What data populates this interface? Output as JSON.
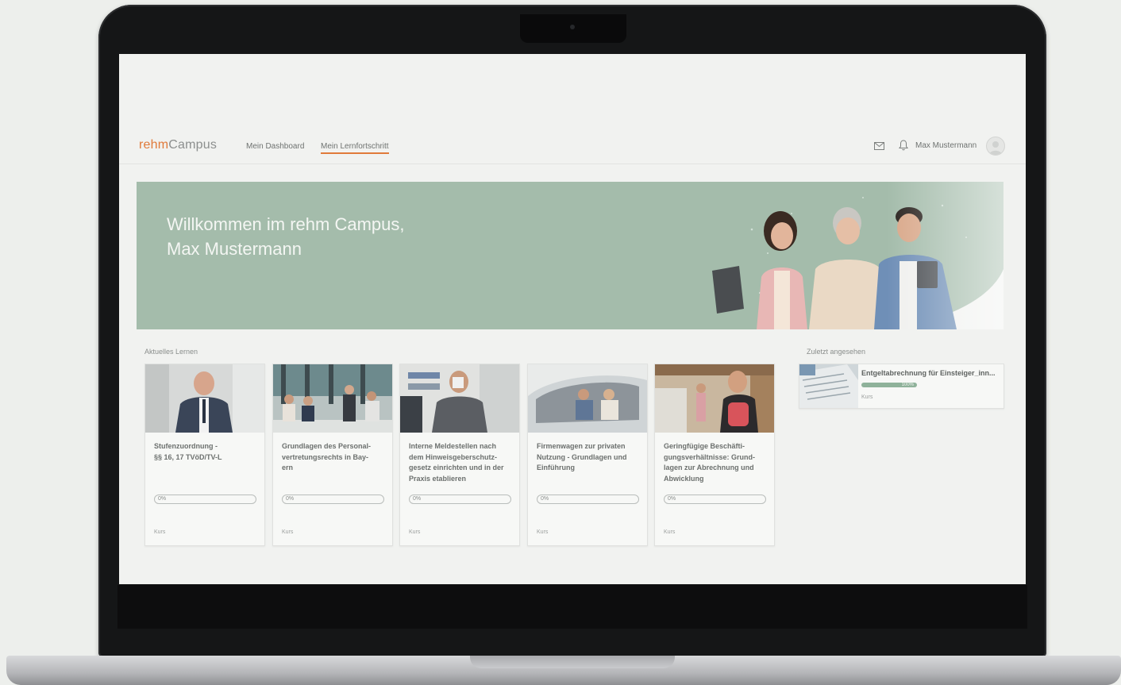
{
  "header": {
    "logo_part1": "rehm",
    "logo_part2": "Campus",
    "nav": [
      "Mein Dashboard",
      "Mein Lernfortschritt"
    ],
    "active_nav": "Mein Lernfortschritt",
    "user_name": "Max Mustermann"
  },
  "hero": {
    "title": "Willkommen im rehm Campus,\nMax Mustermann"
  },
  "current_learning": {
    "label": "Aktuelles Lernen",
    "courses": [
      {
        "title": "Stufenzuordnung -\n§§ 16, 17 TVöD/TV-L",
        "progress": "0%",
        "type": "Kurs"
      },
      {
        "title": "Grundlagen des Personal-\nvertretungsrechts in Bay-\nern",
        "progress": "0%",
        "type": "Kurs"
      },
      {
        "title": "Interne Meldestellen nach\ndem Hinweisgeberschutz-\ngesetz einrichten und in der\nPraxis etablieren",
        "progress": "0%",
        "type": "Kurs"
      },
      {
        "title": "Firmenwagen zur privaten\nNutzung - Grundlagen und\nEinführung",
        "progress": "0%",
        "type": "Kurs"
      },
      {
        "title": "Geringfügige Beschäfti-\ngungsverhältnisse: Grund-\nlagen zur Abrechnung und\nAbwicklung",
        "progress": "0%",
        "type": "Kurs"
      }
    ]
  },
  "recently_viewed": {
    "label": "Zuletzt angesehen",
    "item": {
      "title": "Entgeltabrechnung für Einsteiger_inn...",
      "progress": "100%",
      "type": "Kurs"
    }
  },
  "colors": {
    "accent": "#e07a3a",
    "hero_bg": "#a4bcab",
    "progress_fill": "#8fb29a"
  },
  "icons": [
    "mail-icon",
    "bell-icon",
    "user-avatar-icon"
  ]
}
